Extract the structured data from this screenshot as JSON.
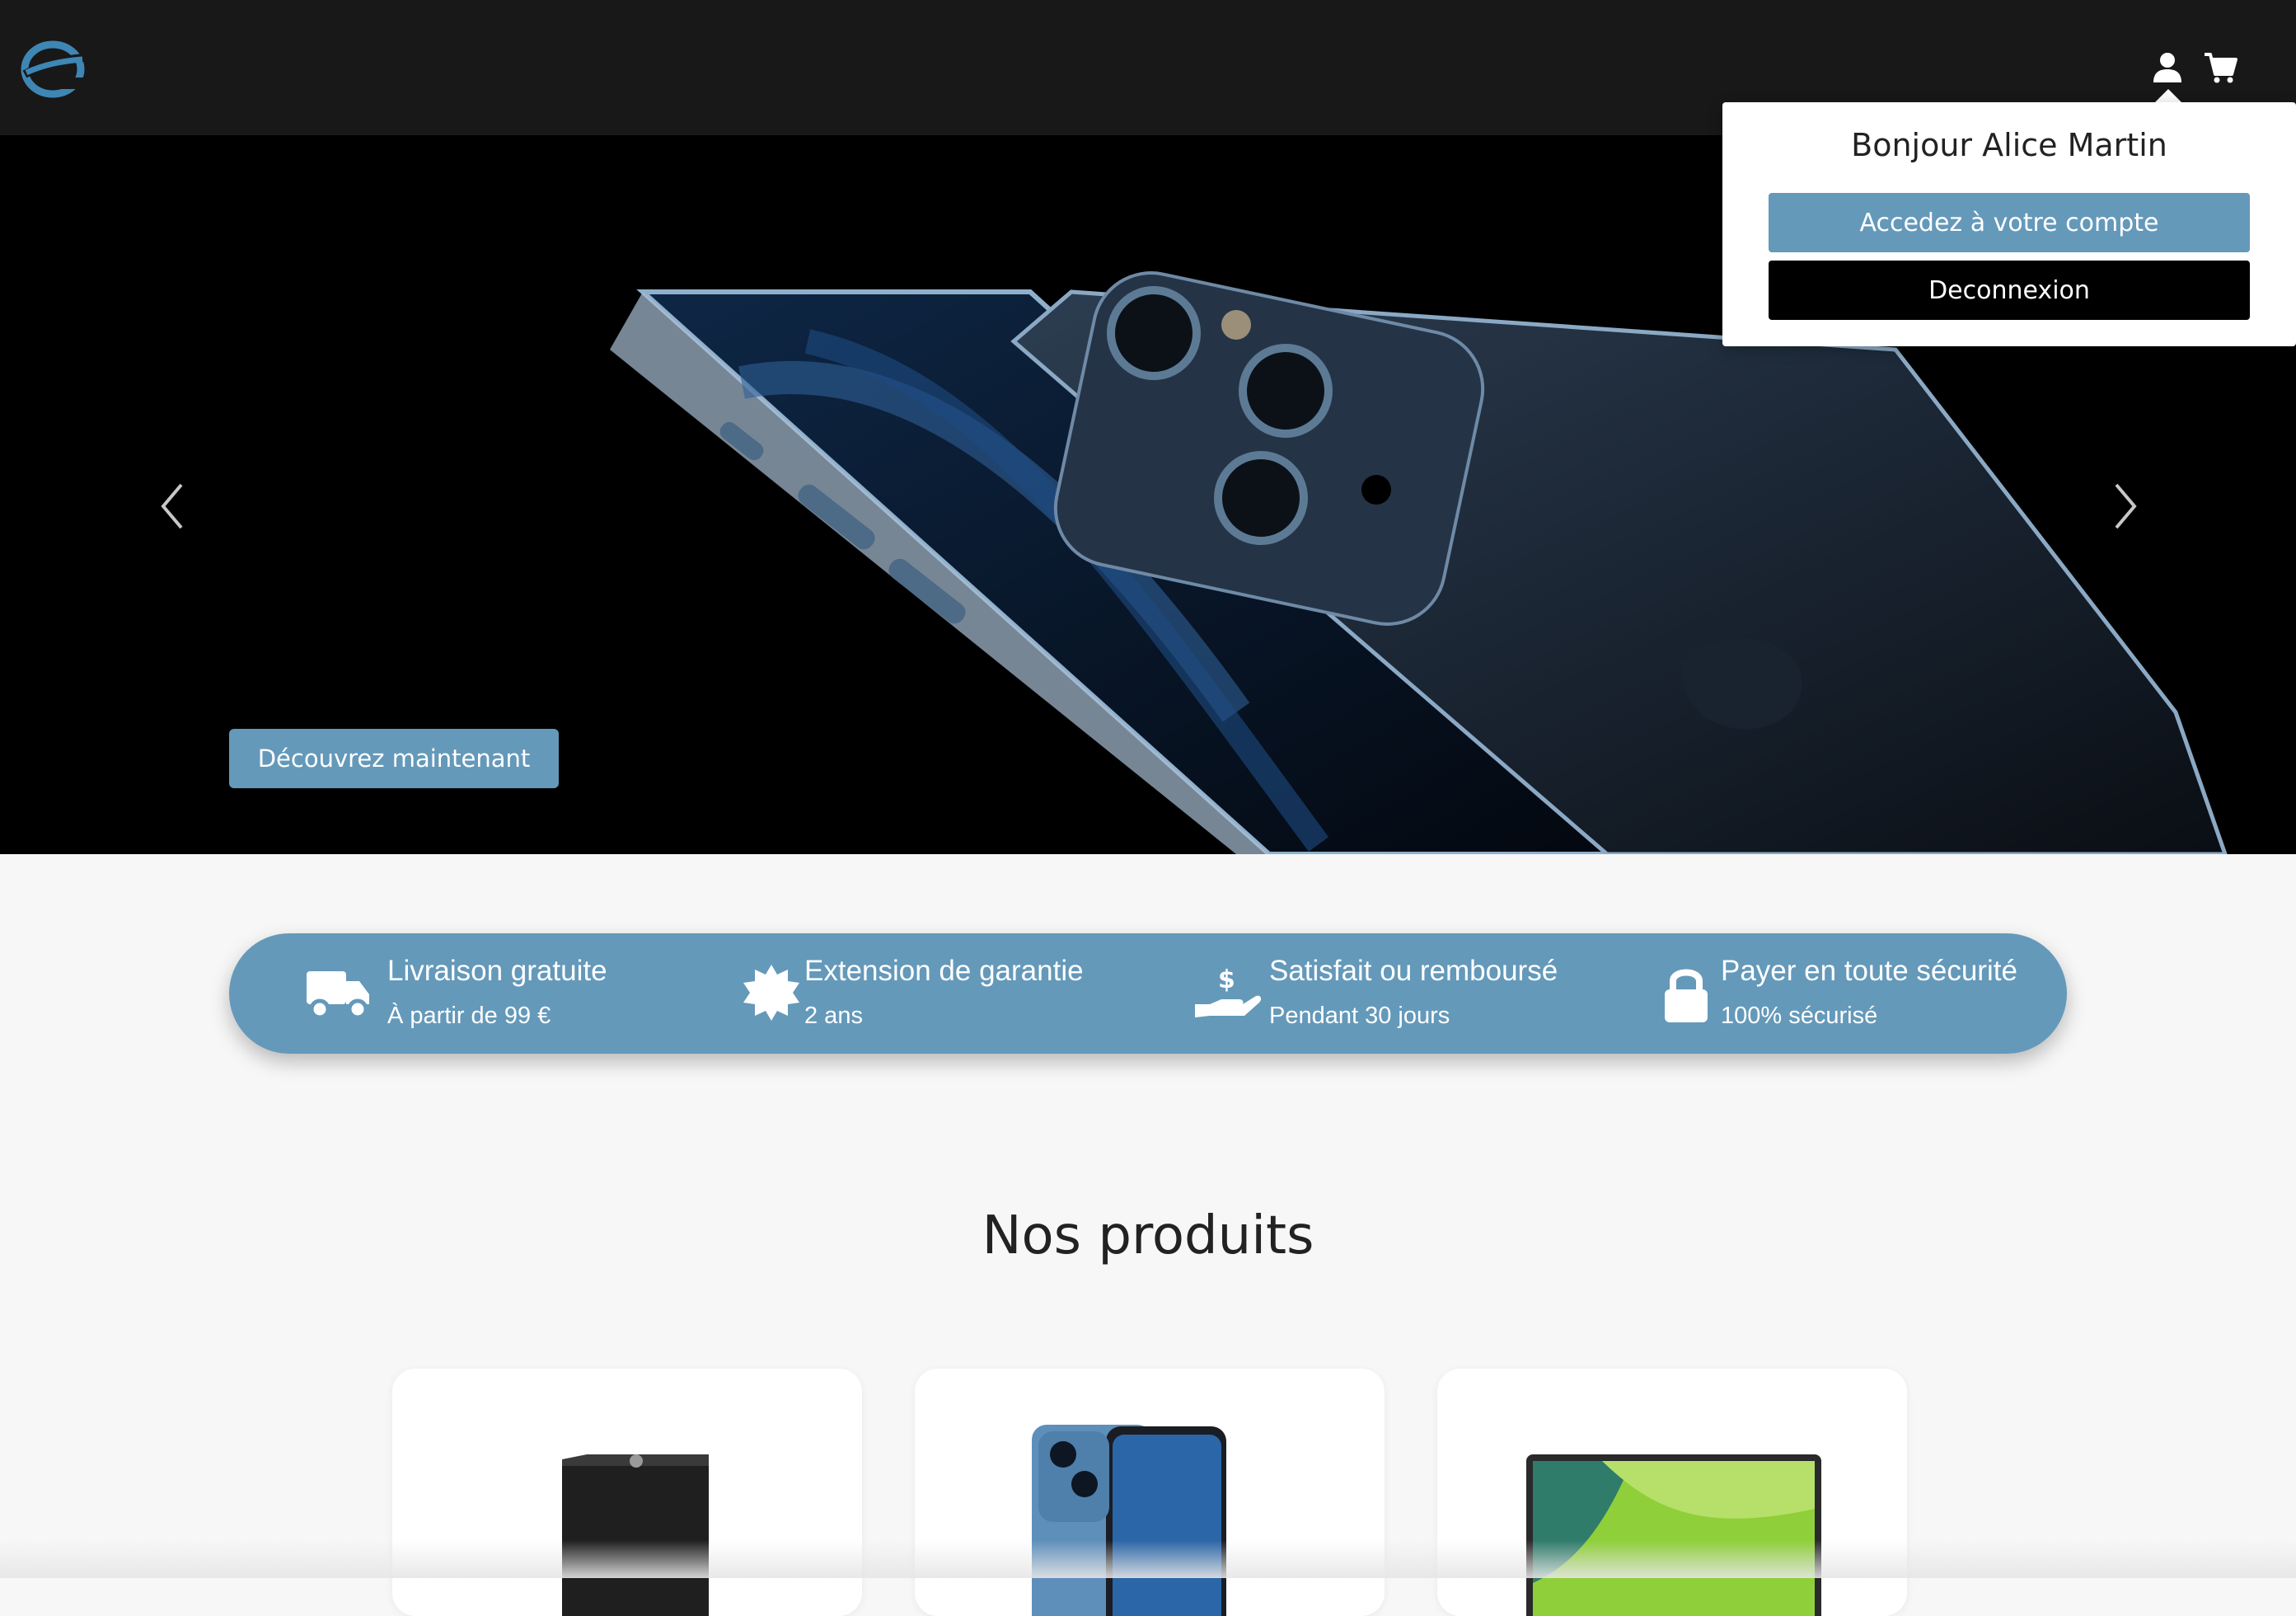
{
  "header": {
    "logo_icon": "e-logo-icon",
    "user_icon": "user-icon",
    "cart_icon": "cart-icon"
  },
  "account_menu": {
    "greeting": "Bonjour Alice Martin",
    "account_label": "Accedez à votre compte",
    "logout_label": "Deconnexion"
  },
  "hero": {
    "cta_label": "Découvrez maintenant",
    "prev_icon": "chevron-left-icon",
    "next_icon": "chevron-right-icon"
  },
  "features": [
    {
      "icon": "truck-icon",
      "title": "Livraison gratuite",
      "subtitle": "À partir de 99 €"
    },
    {
      "icon": "badge-icon",
      "title": "Extension de garantie",
      "subtitle": "2 ans"
    },
    {
      "icon": "money-hand-icon",
      "title": "Satisfait ou remboursé",
      "subtitle": "Pendant 30 jours"
    },
    {
      "icon": "lock-icon",
      "title": "Payer en toute sécurité",
      "subtitle": "100% sécurisé"
    }
  ],
  "products": {
    "title": "Nos produits",
    "items": [
      {
        "image": "console-image"
      },
      {
        "image": "smartphone-image"
      },
      {
        "image": "laptop-image"
      }
    ]
  },
  "colors": {
    "accent": "#6499ba",
    "header_bg": "#181818",
    "page_bg": "#f7f7f7"
  }
}
